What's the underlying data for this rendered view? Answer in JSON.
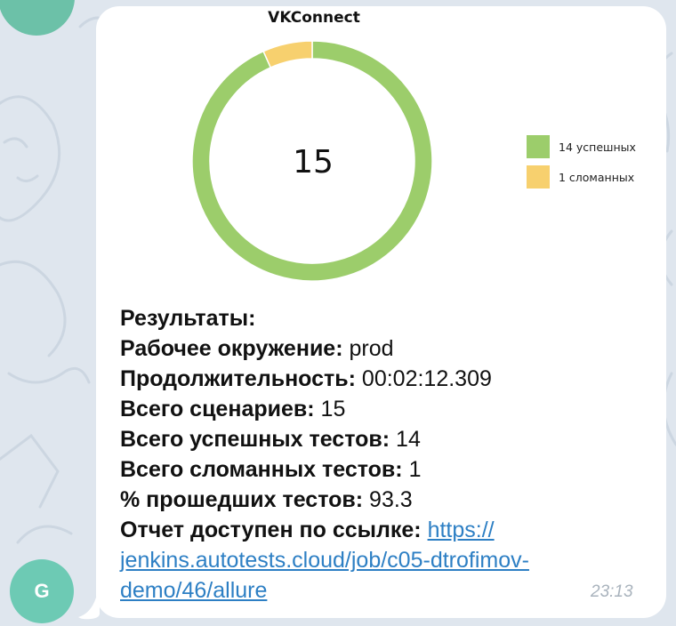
{
  "message": {
    "sender_initial": "G",
    "time": "23:13",
    "chart_title": "VKConnect",
    "center_total": "15",
    "legend": [
      {
        "label": "14 успешных",
        "color": "#9ccd6b"
      },
      {
        "label": "1 сломанных",
        "color": "#f7d06e"
      }
    ],
    "results_heading": "Результаты:",
    "environment_label": "Рабочее окружение:",
    "environment_value": "prod",
    "duration_label": "Продолжительность:",
    "duration_value": "00:02:12.309",
    "scenarios_label": "Всего сценариев:",
    "scenarios_value": "15",
    "passed_label": "Всего успешных тестов:",
    "passed_value": "14",
    "broken_label": "Всего сломанных тестов:",
    "broken_value": "1",
    "percent_label": "% прошедших тестов:",
    "percent_value": "93.3",
    "report_label": "Отчет доступен по ссылке:",
    "report_link": "https://jenkins.autotests.cloud/job/c05-dtrofimov-demo/46/allure",
    "report_link_lines": [
      "https://",
      "jenkins.autotests.cloud/job/c05-dtrofimov-",
      "demo/46/allure"
    ]
  },
  "chart_data": {
    "type": "pie",
    "title": "VKConnect",
    "categories": [
      "14 успешных",
      "1 сломанных"
    ],
    "values": [
      14,
      1
    ],
    "colors": [
      "#9ccd6b",
      "#f7d06e"
    ],
    "center_label": "15",
    "legend_position": "right"
  }
}
